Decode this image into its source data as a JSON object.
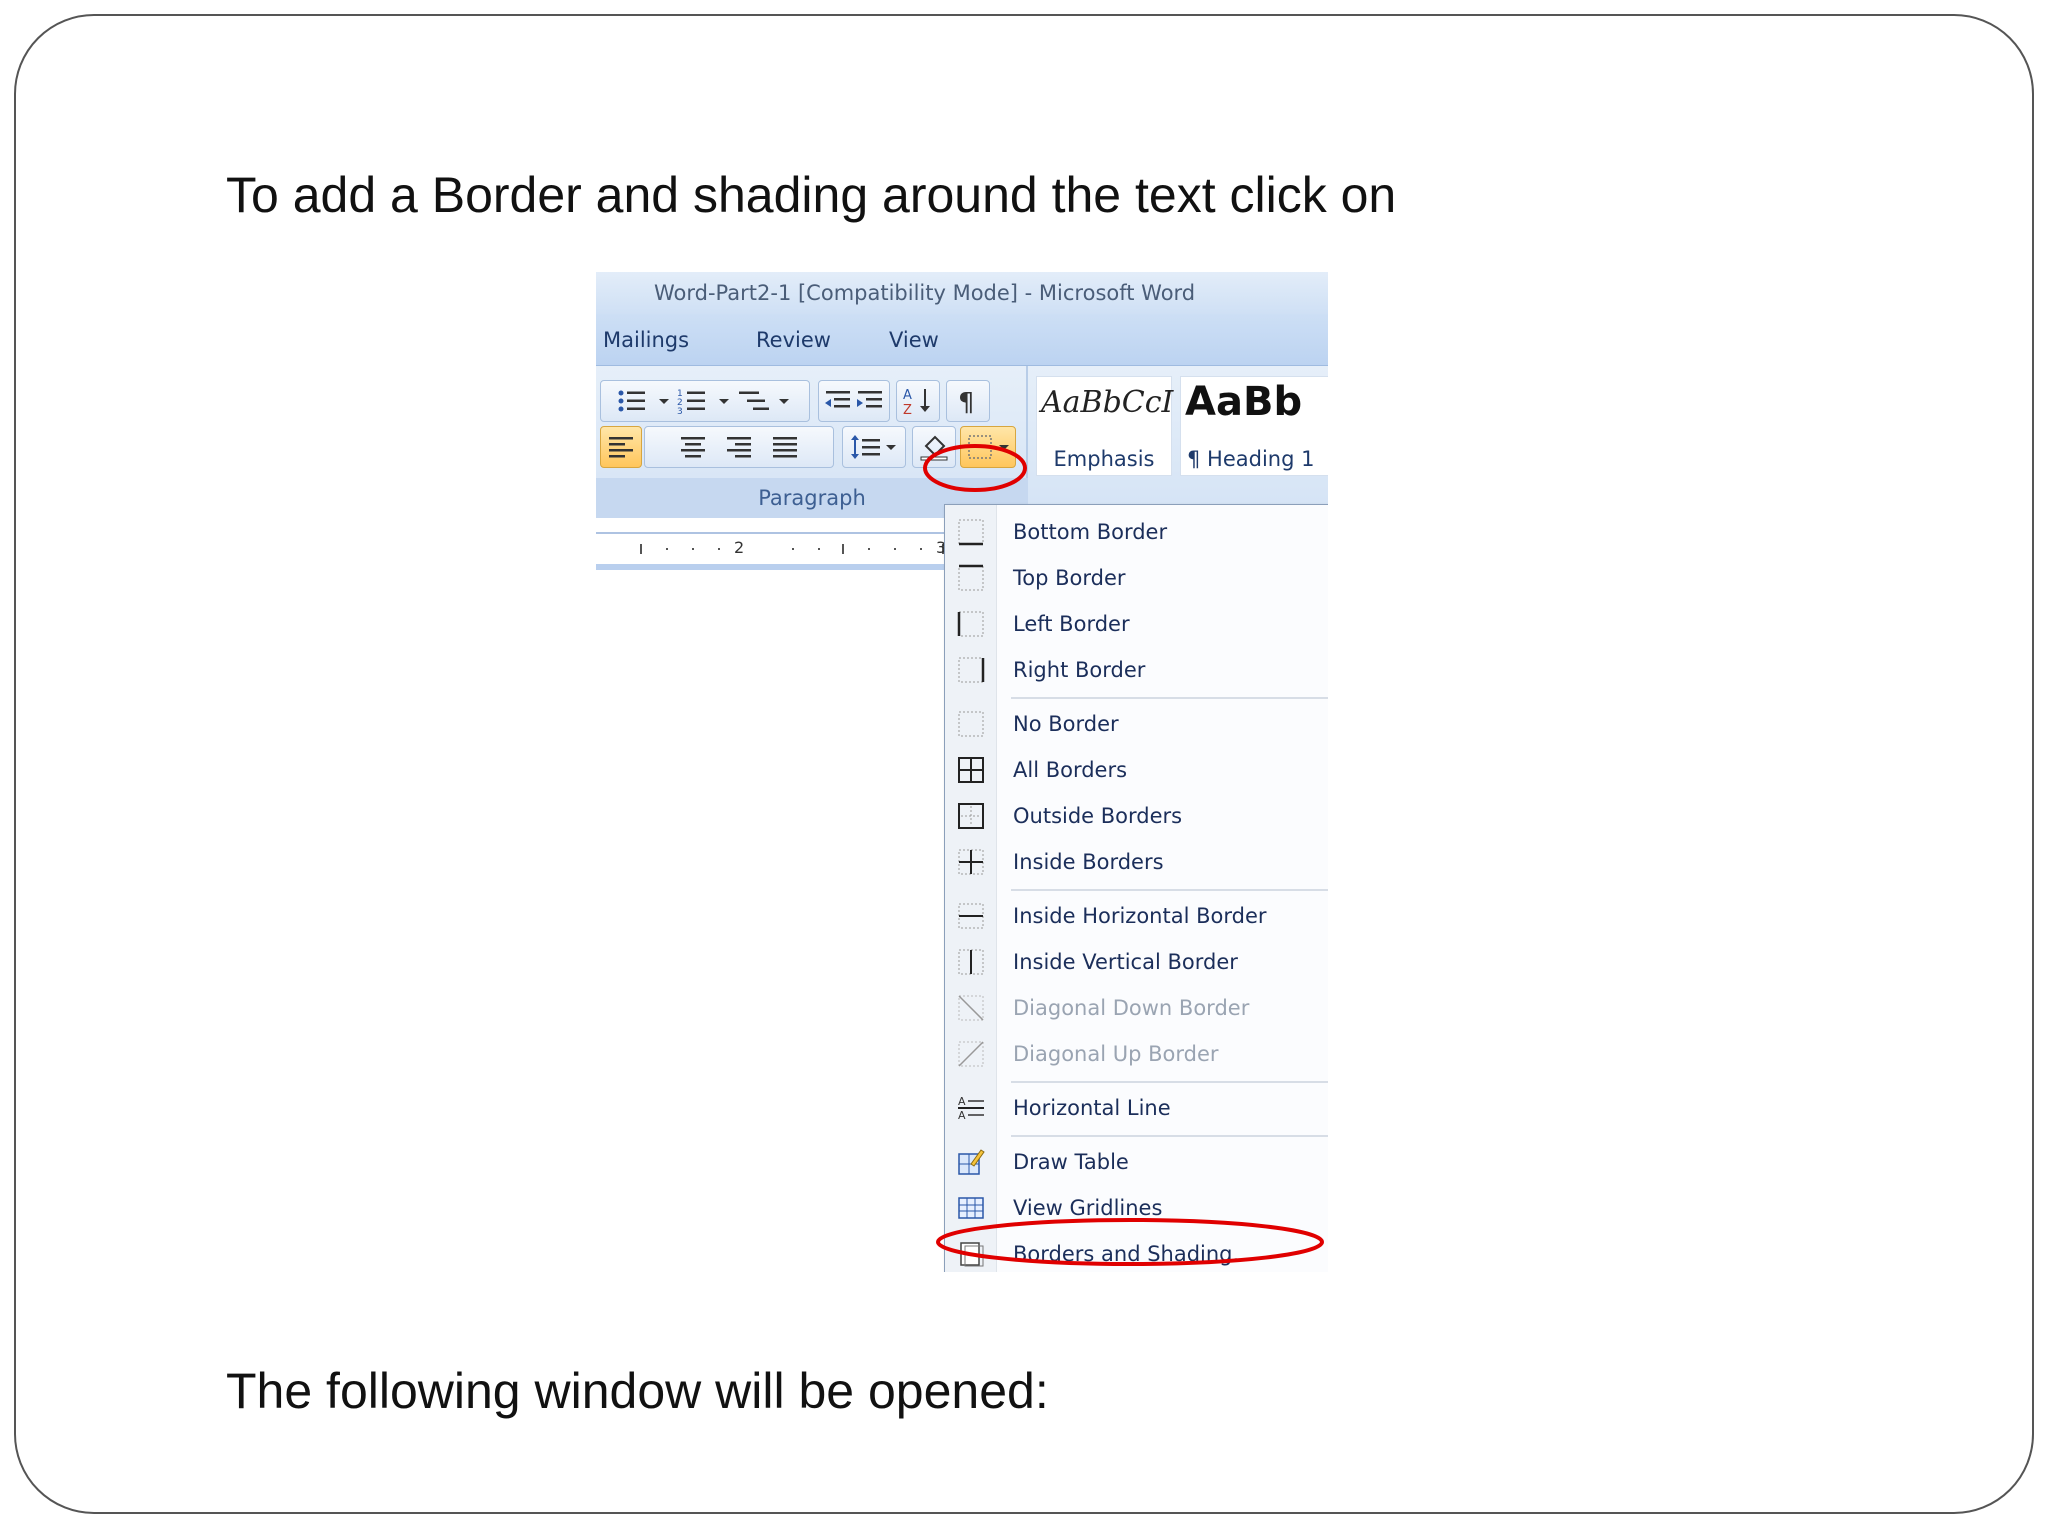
{
  "slide": {
    "intro_text": "To add a Border and shading around the text click on",
    "outro_text": "The following window will be opened:"
  },
  "window": {
    "title": "Word-Part2-1 [Compatibility Mode] - Microsoft Word",
    "tabs": [
      "Mailings",
      "Review",
      "View"
    ]
  },
  "ribbon": {
    "group_label": "Paragraph",
    "styles": [
      {
        "sample": "AaBbCcI",
        "name": "Emphasis"
      },
      {
        "sample": "AaBb",
        "name": "¶ Heading 1"
      }
    ],
    "ruler_numbers": [
      "2",
      "3"
    ]
  },
  "border_menu": {
    "items": [
      {
        "label": "Bottom Border",
        "icon": "bottom-border-icon",
        "enabled": true
      },
      {
        "label": "Top Border",
        "icon": "top-border-icon",
        "enabled": true
      },
      {
        "label": "Left Border",
        "icon": "left-border-icon",
        "enabled": true
      },
      {
        "label": "Right Border",
        "icon": "right-border-icon",
        "enabled": true
      },
      {
        "label": "No Border",
        "icon": "no-border-icon",
        "enabled": true
      },
      {
        "label": "All Borders",
        "icon": "all-borders-icon",
        "enabled": true
      },
      {
        "label": "Outside Borders",
        "icon": "outside-borders-icon",
        "enabled": true
      },
      {
        "label": "Inside Borders",
        "icon": "inside-borders-icon",
        "enabled": true
      },
      {
        "label": "Inside Horizontal Border",
        "icon": "inside-horizontal-border-icon",
        "enabled": true
      },
      {
        "label": "Inside Vertical Border",
        "icon": "inside-vertical-border-icon",
        "enabled": true
      },
      {
        "label": "Diagonal Down Border",
        "icon": "diagonal-down-border-icon",
        "enabled": false
      },
      {
        "label": "Diagonal Up Border",
        "icon": "diagonal-up-border-icon",
        "enabled": false
      },
      {
        "label": "Horizontal Line",
        "icon": "horizontal-line-icon",
        "enabled": true
      },
      {
        "label": "Draw Table",
        "icon": "draw-table-icon",
        "enabled": true
      },
      {
        "label": "View Gridlines",
        "icon": "view-gridlines-icon",
        "enabled": true
      },
      {
        "label": "Borders and Shading...",
        "icon": "borders-and-shading-icon",
        "enabled": true
      }
    ]
  },
  "colors": {
    "highlight_ring": "#e00000",
    "active_button": "#ffc65c",
    "ribbon_blue": "#cfe0f5"
  }
}
